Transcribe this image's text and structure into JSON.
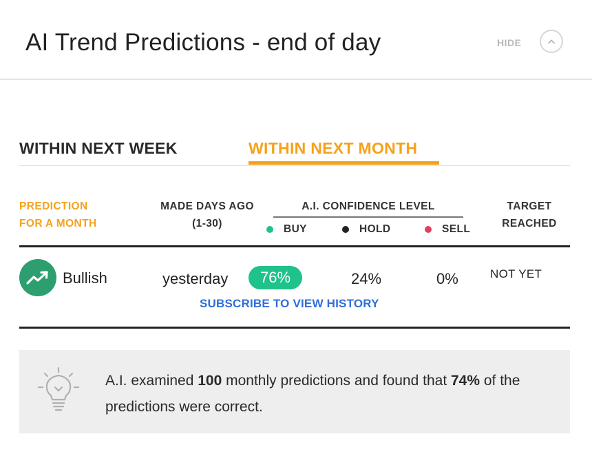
{
  "header": {
    "title": "AI Trend Predictions - end of day",
    "hide_label": "HIDE",
    "collapse_icon": "chevron-up-icon"
  },
  "tabs": [
    {
      "label": "WITHIN NEXT WEEK",
      "active": false
    },
    {
      "label": "WITHIN NEXT MONTH",
      "active": true
    }
  ],
  "columns": {
    "prediction": [
      "PREDICTION",
      "FOR A MONTH"
    ],
    "made_days_ago": [
      "MADE DAYS AGO",
      "(1-30)"
    ],
    "confidence": "A.I. CONFIDENCE LEVEL",
    "target": [
      "TARGET",
      "REACHED"
    ]
  },
  "legend": [
    {
      "label": "BUY",
      "color": "#1fc28a"
    },
    {
      "label": "HOLD",
      "color": "#222222"
    },
    {
      "label": "SELL",
      "color": "#e0405e"
    }
  ],
  "row": {
    "icon": "trending-up-icon",
    "prediction": "Bullish",
    "made": "yesterday",
    "buy": "76%",
    "hold": "24%",
    "sell": "0%",
    "target": "NOT YET",
    "subscribe_link": "SUBSCRIBE TO VIEW HISTORY"
  },
  "info": {
    "icon": "lightbulb-icon",
    "part1": "A.I. examined ",
    "count": "100",
    "part2": " monthly predictions and found that ",
    "percent": "74%",
    "part3": " of the predictions were correct."
  },
  "colors": {
    "accent": "#f5a21b",
    "bullish": "#2c9e6f",
    "buy_badge": "#1fc28a",
    "link": "#2f6fd8"
  }
}
